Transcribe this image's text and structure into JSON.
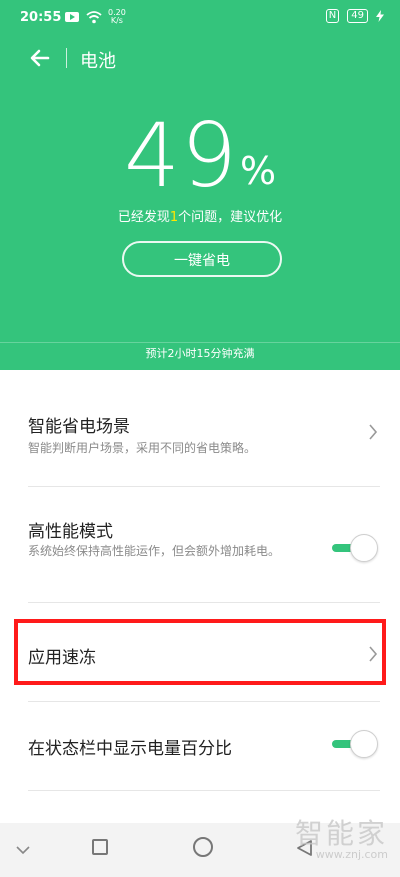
{
  "statusbar": {
    "time": "20:55",
    "net_speed_value": "0.20",
    "net_speed_unit": "K/s",
    "nfc_label": "N",
    "battery_level": "49"
  },
  "header": {
    "title": "电池"
  },
  "battery": {
    "percent_value": "49",
    "percent_sign": "%",
    "suggestion_prefix": "已经发现",
    "suggestion_count": "1",
    "suggestion_suffix": "个问题，建议优化",
    "save_button_label": "一键省电",
    "charge_estimate": "预计2小时15分钟充满"
  },
  "settings": {
    "smart_scene": {
      "title": "智能省电场景",
      "desc": "智能判断用户场景，采用不同的省电策略。"
    },
    "high_perf": {
      "title": "高性能模式",
      "desc": "系统始终保持高性能运作，但会额外增加耗电。",
      "enabled": true
    },
    "app_freeze": {
      "title": "应用速冻"
    },
    "show_percent": {
      "title": "在状态栏中显示电量百分比",
      "enabled": true
    }
  },
  "watermark": {
    "big": "智能家",
    "small": "www.znj.com"
  },
  "colors": {
    "accent": "#34c47c",
    "highlight": "#ff1a1a"
  }
}
